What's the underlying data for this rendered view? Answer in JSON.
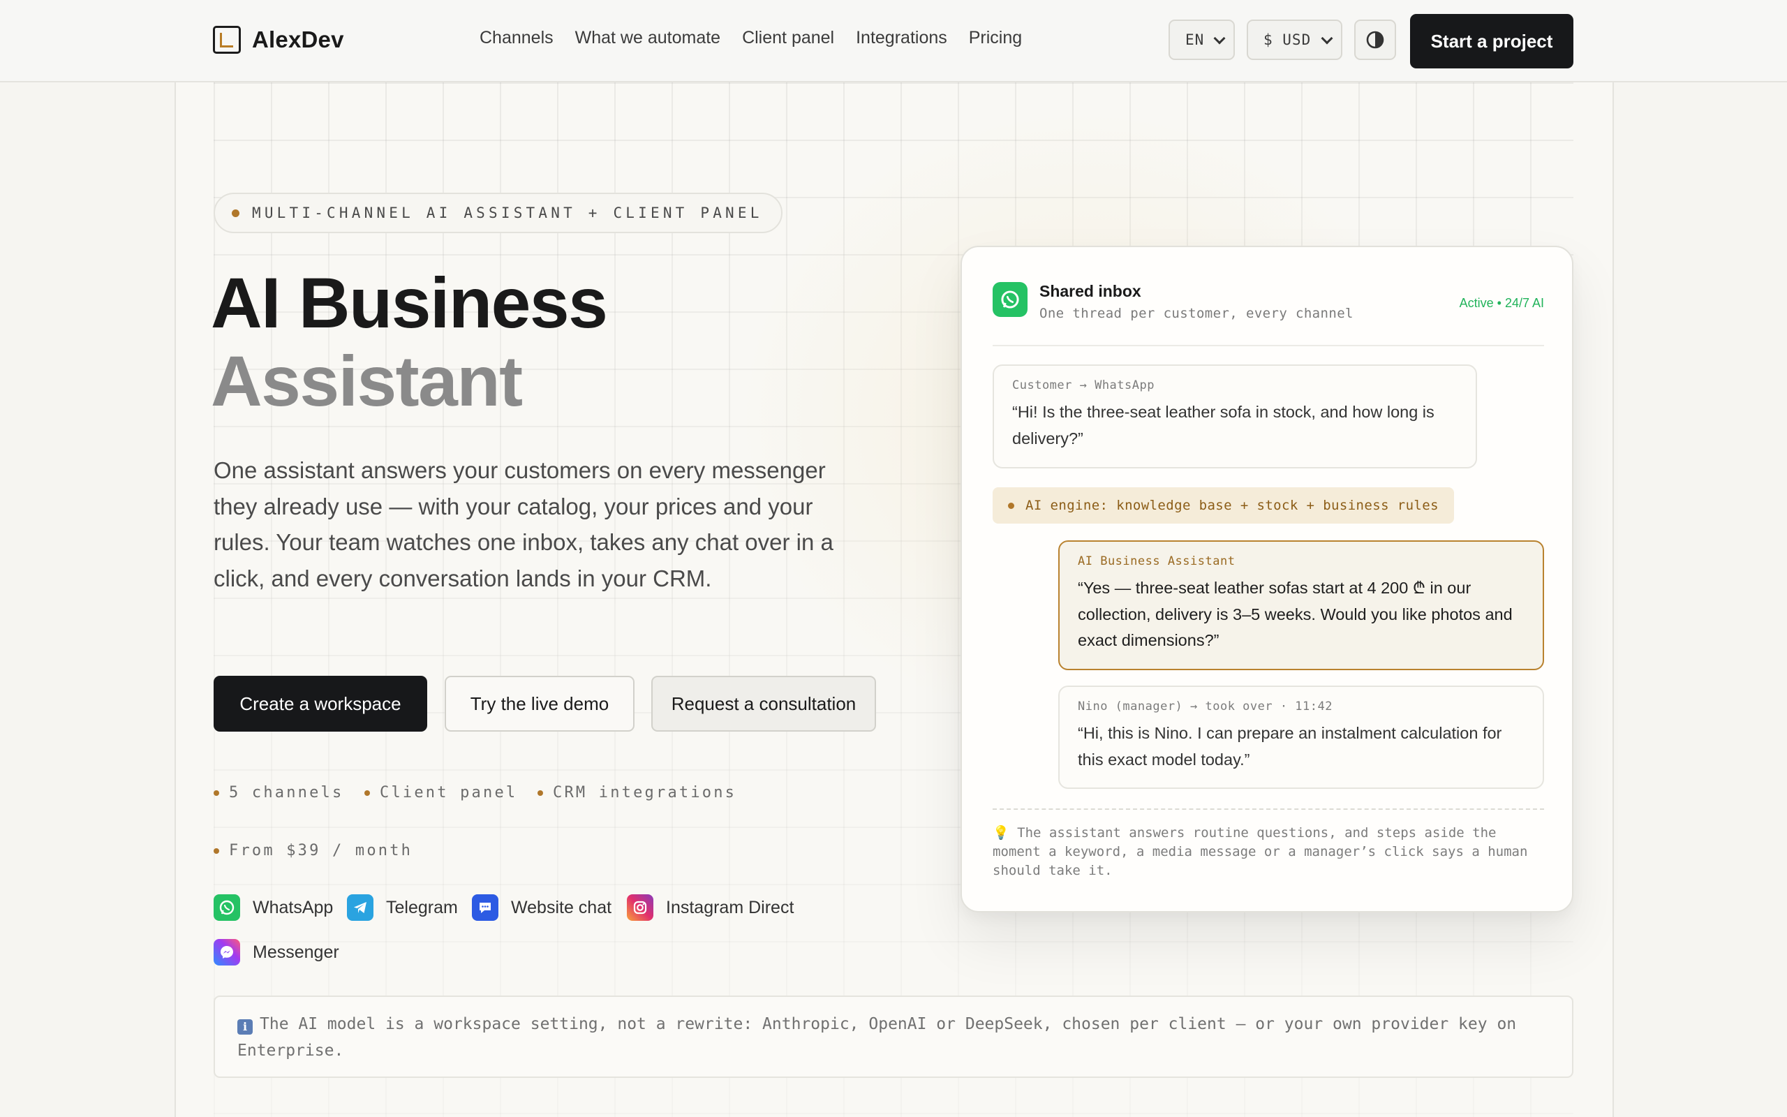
{
  "header": {
    "logo_text": "AlexDev",
    "nav": [
      "Channels",
      "What we automate",
      "Client panel",
      "Integrations",
      "Pricing"
    ],
    "language": "EN",
    "currency": "$ USD",
    "theme_icon": "contrast-icon",
    "cta_label": "Start a project"
  },
  "hero": {
    "eyebrow": "MULTI-CHANNEL AI ASSISTANT + CLIENT PANEL",
    "title_line1": "AI Business",
    "title_line2": "Assistant",
    "lead": "One assistant answers your customers on every messenger they already use — with your catalog, your prices and your rules. Your team watches one inbox, takes any chat over in a click, and every conversation lands in your CRM.",
    "buttons": {
      "primary": "Create a workspace",
      "secondary": "Try the live demo",
      "tertiary": "Request a consultation"
    },
    "features": [
      "5 channels",
      "Client panel",
      "CRM integrations",
      "From $39 / month"
    ],
    "channels": [
      {
        "name": "WhatsApp",
        "icon": "whatsapp-icon",
        "color": "#25c264"
      },
      {
        "name": "Telegram",
        "icon": "telegram-icon",
        "color": "#2aa3e0"
      },
      {
        "name": "Website chat",
        "icon": "chat-bubble-icon",
        "color": "#2d5be3"
      },
      {
        "name": "Instagram Direct",
        "icon": "instagram-icon",
        "color": "#e1306c"
      },
      {
        "name": "Messenger",
        "icon": "messenger-icon",
        "color": "#8b4cf2"
      }
    ],
    "model_note": "The AI model is a workspace setting, not a rewrite: Anthropic, OpenAI or DeepSeek, chosen per client — or your own provider key on Enterprise."
  },
  "inbox": {
    "title": "Shared inbox",
    "subtitle": "One thread per customer, every channel",
    "status": "Active • 24/7 AI",
    "messages": [
      {
        "tag": "Customer → WhatsApp",
        "text": "“Hi! Is the three-seat leather sofa in stock, and how long is delivery?”"
      },
      {
        "tag": "AI Business Assistant",
        "text": "“Yes — three-seat leather sofas start at 4 200 ₾ in our collection, delivery is 3–5 weeks. Would you like photos and exact dimensions?”"
      },
      {
        "tag": "Nino (manager) → took over · 11:42",
        "text": "“Hi, this is Nino. I can prepare an instalment calculation for this exact model today.”"
      }
    ],
    "engine_label": "AI engine: knowledge base + stock + business rules",
    "footer_note": "The assistant answers routine questions, and steps aside the moment a keyword, a media message or a manager’s click says a human should take it."
  },
  "colors": {
    "accent": "#b0772a",
    "dark": "#17181a",
    "status_green": "#21b35a"
  }
}
